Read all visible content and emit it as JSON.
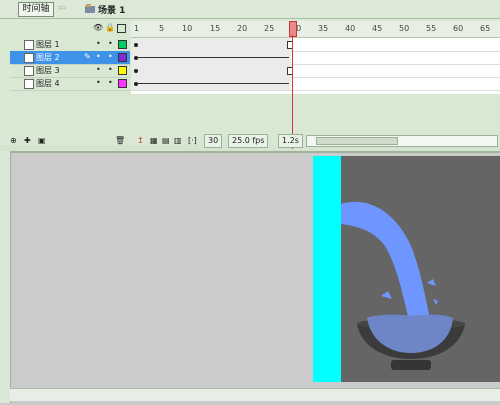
{
  "toolbar": {
    "timeline_tab": "时间轴",
    "scene_label": "场景 1"
  },
  "layers": [
    {
      "name": "图层 1",
      "color": "#00cc66",
      "selected": false
    },
    {
      "name": "图层 2",
      "color": "#7a2ed6",
      "selected": true
    },
    {
      "name": "图层 3",
      "color": "#ffff00",
      "selected": false
    },
    {
      "name": "图层 4",
      "color": "#ff33ff",
      "selected": false
    }
  ],
  "ruler": {
    "labels": [
      "1",
      "5",
      "10",
      "15",
      "20",
      "25",
      "30",
      "35",
      "40",
      "45",
      "50",
      "55",
      "60",
      "65"
    ]
  },
  "status": {
    "current_frame": "30",
    "frame_rate": "25.0 fps",
    "elapsed_time": "1.2s"
  },
  "colors": {
    "water": "#6f96ff",
    "cyan_panel": "#00ffff",
    "canvas": "#656565",
    "selected_layer": "#3e93e8"
  }
}
